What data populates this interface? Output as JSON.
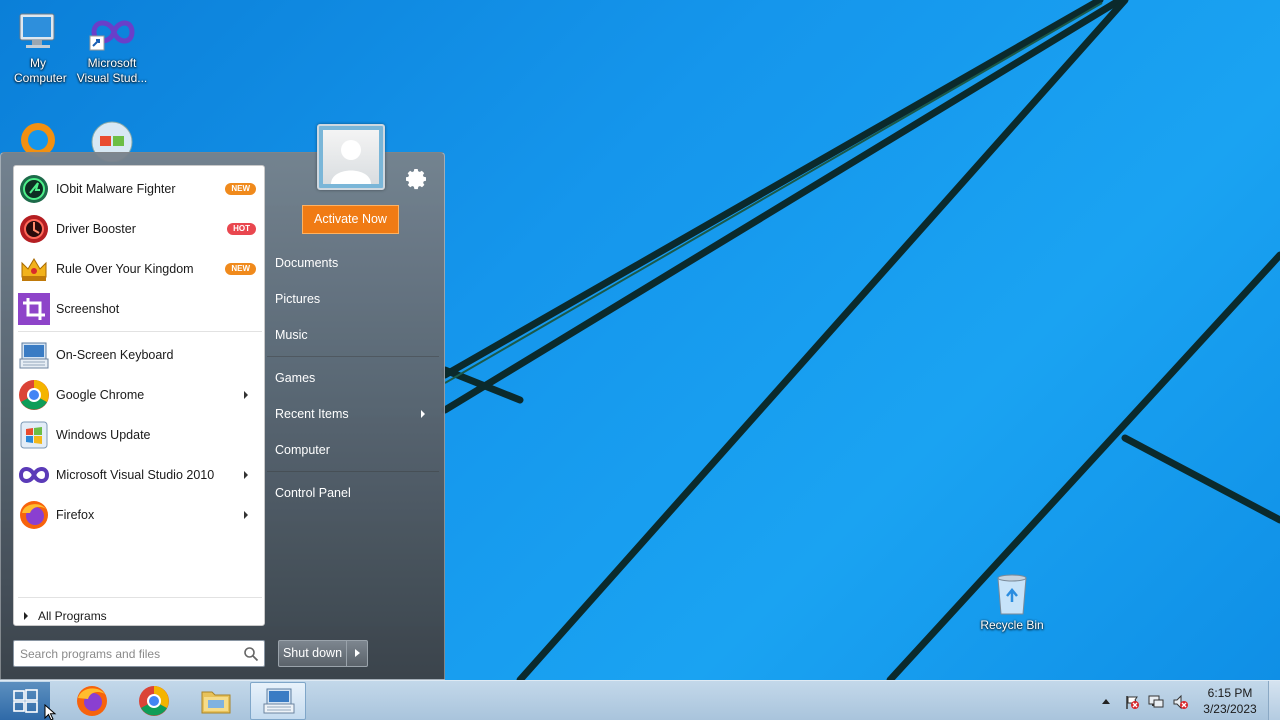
{
  "desktop": {
    "icons": [
      {
        "label": "My Computer",
        "icon": "computer-icon"
      },
      {
        "label": "Microsoft Visual Stud...",
        "icon": "visual-studio-icon"
      },
      {
        "label": "",
        "icon": "app-icon"
      },
      {
        "label": "",
        "icon": "windows-update-icon"
      },
      {
        "label": "Recycle Bin",
        "icon": "recycle-bin-icon"
      }
    ]
  },
  "start_menu": {
    "pinned": [
      {
        "label": "IObit Malware Fighter",
        "badge": "NEW",
        "icon": "iobit-malware-fighter-icon"
      },
      {
        "label": "Driver Booster",
        "badge": "HOT",
        "icon": "driver-booster-icon"
      },
      {
        "label": "Rule Over Your Kingdom",
        "badge": "NEW",
        "icon": "crown-icon"
      },
      {
        "label": "Screenshot",
        "icon": "screenshot-crop-icon"
      }
    ],
    "recent": [
      {
        "label": "On-Screen Keyboard",
        "icon": "keyboard-icon"
      },
      {
        "label": "Google Chrome",
        "icon": "chrome-icon",
        "submenu": true
      },
      {
        "label": "Windows Update",
        "icon": "windows-update-icon"
      },
      {
        "label": "Microsoft Visual Studio 2010",
        "icon": "visual-studio-icon",
        "submenu": true
      },
      {
        "label": "Firefox",
        "icon": "firefox-icon",
        "submenu": true
      }
    ],
    "all_programs": "All Programs",
    "search_placeholder": "Search programs and files",
    "activate": "Activate Now",
    "right_links": [
      {
        "label": "Documents"
      },
      {
        "label": "Pictures"
      },
      {
        "label": "Music"
      },
      {
        "label": "Games"
      },
      {
        "label": "Recent Items",
        "submenu": true
      },
      {
        "label": "Computer"
      },
      {
        "label": "Control Panel"
      }
    ],
    "shutdown": "Shut down"
  },
  "taskbar": {
    "apps": [
      "firefox-icon",
      "chrome-icon",
      "file-explorer-icon",
      "on-screen-keyboard-icon"
    ],
    "tray": [
      "action-center-flag-icon",
      "network-icon",
      "volume-muted-icon"
    ],
    "time": "6:15 PM",
    "date": "3/23/2023"
  },
  "colors": {
    "accent_orange": "#f07b14",
    "badge_new": "#f08a1c",
    "badge_hot": "#e9474f",
    "desktop_blue": "#1596ec"
  }
}
